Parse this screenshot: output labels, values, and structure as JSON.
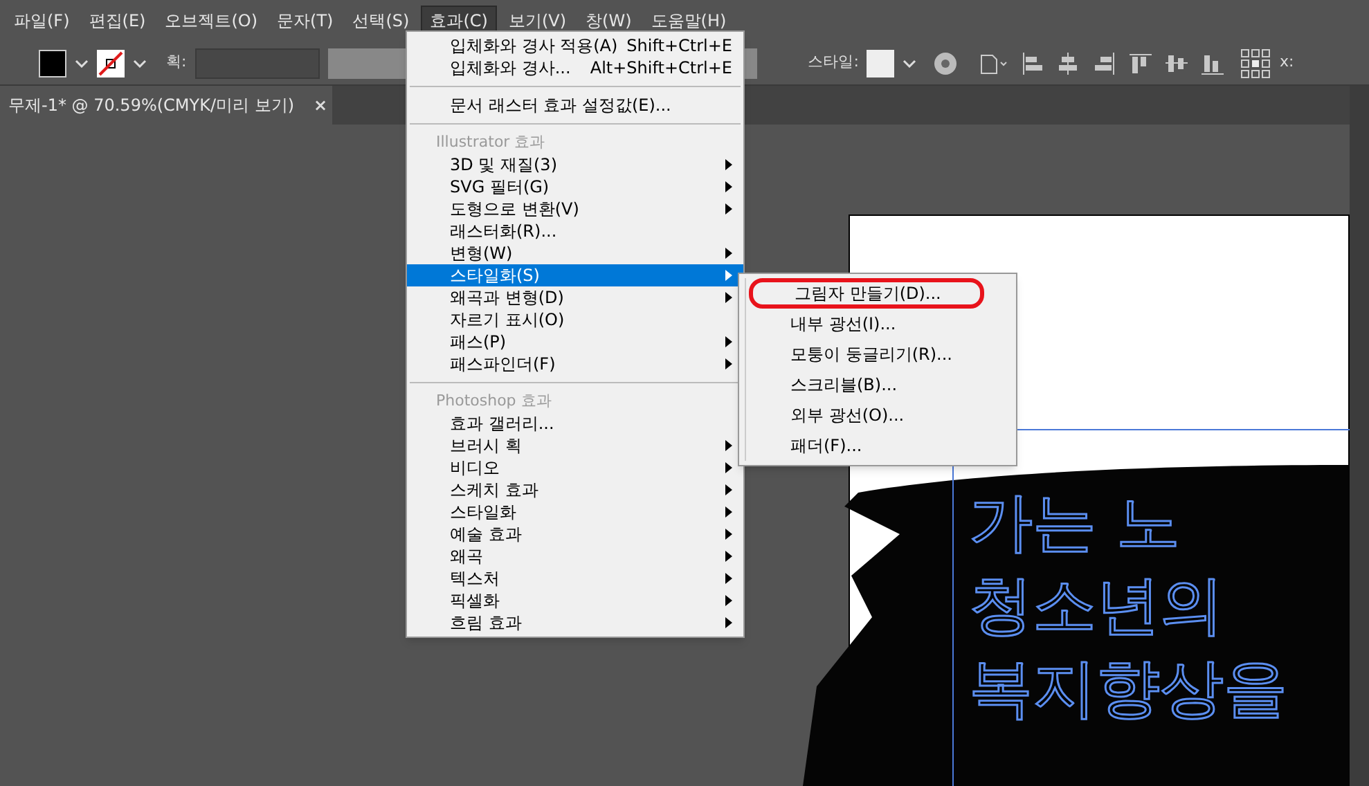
{
  "menu_bar": [
    {
      "label": "파일(F)",
      "selected": false
    },
    {
      "label": "편집(E)",
      "selected": false
    },
    {
      "label": "오브젝트(O)",
      "selected": false
    },
    {
      "label": "문자(T)",
      "selected": false
    },
    {
      "label": "선택(S)",
      "selected": false
    },
    {
      "label": "효과(C)",
      "selected": true
    },
    {
      "label": "보기(V)",
      "selected": false
    },
    {
      "label": "창(W)",
      "selected": false
    },
    {
      "label": "도움말(H)",
      "selected": false
    }
  ],
  "toolbar": {
    "stroke_label": "획:",
    "style_label": "스타일:",
    "x_label": "x:"
  },
  "document_tab": {
    "title": "무제-1* @ 70.59%(CMYK/미리 보기)",
    "close": "×"
  },
  "effect_menu": [
    {
      "kind": "item",
      "label": "입체화와 경사 적용(A)",
      "shortcut": "Shift+Ctrl+E",
      "submenu": false,
      "selected": false
    },
    {
      "kind": "item",
      "label": "입체화와 경사...",
      "shortcut": "Alt+Shift+Ctrl+E",
      "submenu": false,
      "selected": false
    },
    {
      "kind": "separator"
    },
    {
      "kind": "item",
      "label": "문서 래스터 효과 설정값(E)...",
      "submenu": false,
      "selected": false
    },
    {
      "kind": "separator"
    },
    {
      "kind": "header",
      "label": "Illustrator 효과"
    },
    {
      "kind": "item",
      "label": "3D 및 재질(3)",
      "submenu": true,
      "selected": false
    },
    {
      "kind": "item",
      "label": "SVG 필터(G)",
      "submenu": true,
      "selected": false
    },
    {
      "kind": "item",
      "label": "도형으로 변환(V)",
      "submenu": true,
      "selected": false
    },
    {
      "kind": "item",
      "label": "래스터화(R)...",
      "submenu": false,
      "selected": false
    },
    {
      "kind": "item",
      "label": "변형(W)",
      "submenu": true,
      "selected": false
    },
    {
      "kind": "item",
      "label": "스타일화(S)",
      "submenu": true,
      "selected": true
    },
    {
      "kind": "item",
      "label": "왜곡과 변형(D)",
      "submenu": true,
      "selected": false
    },
    {
      "kind": "item",
      "label": "자르기 표시(O)",
      "submenu": false,
      "selected": false
    },
    {
      "kind": "item",
      "label": "패스(P)",
      "submenu": true,
      "selected": false
    },
    {
      "kind": "item",
      "label": "패스파인더(F)",
      "submenu": true,
      "selected": false
    },
    {
      "kind": "separator"
    },
    {
      "kind": "header",
      "label": "Photoshop 효과"
    },
    {
      "kind": "item",
      "label": "효과 갤러리...",
      "submenu": false,
      "selected": false
    },
    {
      "kind": "item",
      "label": "브러시 획",
      "submenu": true,
      "selected": false
    },
    {
      "kind": "item",
      "label": "비디오",
      "submenu": true,
      "selected": false
    },
    {
      "kind": "item",
      "label": "스케치 효과",
      "submenu": true,
      "selected": false
    },
    {
      "kind": "item",
      "label": "스타일화",
      "submenu": true,
      "selected": false
    },
    {
      "kind": "item",
      "label": "예술 효과",
      "submenu": true,
      "selected": false
    },
    {
      "kind": "item",
      "label": "왜곡",
      "submenu": true,
      "selected": false
    },
    {
      "kind": "item",
      "label": "텍스처",
      "submenu": true,
      "selected": false
    },
    {
      "kind": "item",
      "label": "픽셀화",
      "submenu": true,
      "selected": false
    },
    {
      "kind": "item",
      "label": "흐림 효과",
      "submenu": true,
      "selected": false
    }
  ],
  "stylize_submenu": [
    {
      "label": "그림자 만들기(D)...",
      "circled": true
    },
    {
      "label": "내부 광선(I)...",
      "circled": false
    },
    {
      "label": "모퉁이 둥글리기(R)...",
      "circled": false
    },
    {
      "label": "스크리블(B)...",
      "circled": false
    },
    {
      "label": "외부 광선(O)...",
      "circled": false
    },
    {
      "label": "패더(F)...",
      "circled": false
    }
  ],
  "artboard_text": [
    "가는 노",
    "청소년의",
    "복지향상을"
  ]
}
